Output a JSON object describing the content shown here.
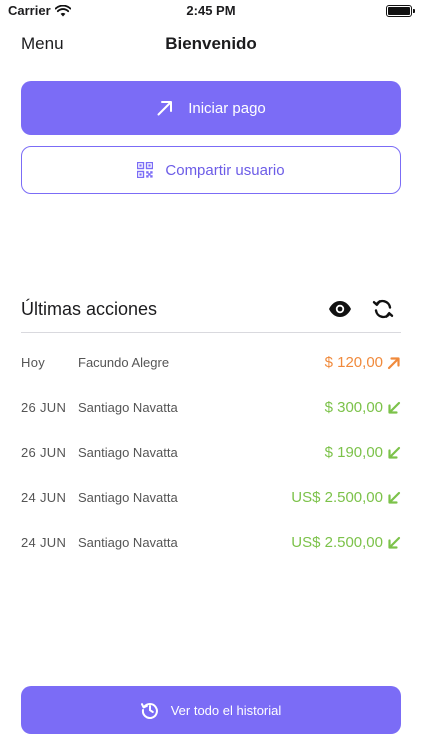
{
  "status_bar": {
    "carrier": "Carrier",
    "time": "2:45 PM",
    "wifi_icon": "wifi-icon",
    "battery_icon": "battery-icon"
  },
  "nav": {
    "menu_label": "Menu",
    "title": "Bienvenido"
  },
  "actions": {
    "start_payment": {
      "label": "Iniciar pago",
      "icon": "arrow-up-right-icon"
    },
    "share_user": {
      "label": "Compartir usuario",
      "icon": "qr-code-icon"
    }
  },
  "recent": {
    "title": "Últimas acciones",
    "toggle_visibility_icon": "eye-icon",
    "refresh_icon": "refresh-icon",
    "transactions": [
      {
        "date": "Hoy",
        "name": "Facundo Alegre",
        "amount": "$ 120,00",
        "direction": "out",
        "icon": "arrow-up-right-icon"
      },
      {
        "date": "26  JUN",
        "name": "Santiago Navatta",
        "amount": "$ 300,00",
        "direction": "in",
        "icon": "arrow-down-left-icon"
      },
      {
        "date": "26  JUN",
        "name": "Santiago Navatta",
        "amount": "$ 190,00",
        "direction": "in",
        "icon": "arrow-down-left-icon"
      },
      {
        "date": "24  JUN",
        "name": "Santiago Navatta",
        "amount": "US$ 2.500,00",
        "direction": "in",
        "icon": "arrow-down-left-icon"
      },
      {
        "date": "24  JUN",
        "name": "Santiago Navatta",
        "amount": "US$ 2.500,00",
        "direction": "in",
        "icon": "arrow-down-left-icon"
      }
    ]
  },
  "history_button": {
    "label": "Ver todo el historial",
    "icon": "history-icon"
  },
  "colors": {
    "accent": "#7b6cf6",
    "outgoing": "#f08a3c",
    "incoming": "#7cc24a"
  }
}
